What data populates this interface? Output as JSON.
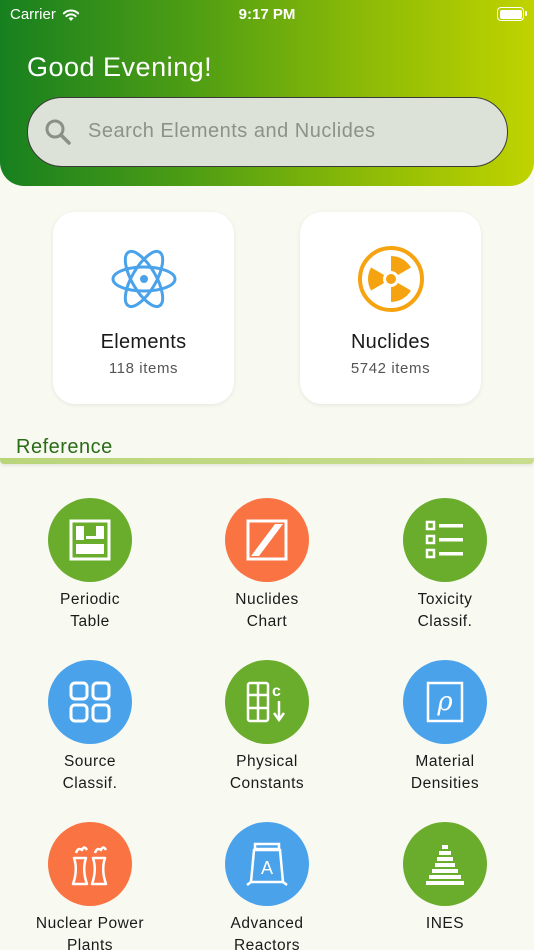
{
  "status_bar": {
    "carrier": "Carrier",
    "time": "9:17 PM"
  },
  "header": {
    "greeting": "Good Evening!"
  },
  "search": {
    "placeholder": "Search Elements and Nuclides"
  },
  "cards": [
    {
      "title": "Elements",
      "subtitle": "118 items",
      "icon": "atom-icon"
    },
    {
      "title": "Nuclides",
      "subtitle": "5742 items",
      "icon": "radiation-icon"
    }
  ],
  "reference": {
    "title": "Reference",
    "items": [
      {
        "line1": "Periodic",
        "line2": "Table",
        "icon": "periodic-table-icon",
        "color": "#6aac2c"
      },
      {
        "line1": "Nuclides",
        "line2": "Chart",
        "icon": "nuclides-chart-icon",
        "color": "#fa7343"
      },
      {
        "line1": "Toxicity",
        "line2": "Classif.",
        "icon": "list-icon",
        "color": "#6aac2c"
      },
      {
        "line1": "Source",
        "line2": "Classif.",
        "icon": "grid-icon",
        "color": "#4aa3ea"
      },
      {
        "line1": "Physical",
        "line2": "Constants",
        "icon": "constants-icon",
        "color": "#6aac2c"
      },
      {
        "line1": "Material",
        "line2": "Densities",
        "icon": "rho-icon",
        "color": "#4aa3ea"
      },
      {
        "line1": "Nuclear Power",
        "line2": "Plants",
        "icon": "cooling-tower-icon",
        "color": "#fa7343"
      },
      {
        "line1": "Advanced",
        "line2": "Reactors",
        "icon": "reactor-icon",
        "color": "#4aa3ea"
      },
      {
        "line1": "INES",
        "line2": "",
        "icon": "ines-pyramid-icon",
        "color": "#6aac2c"
      }
    ]
  },
  "colors": {
    "header_start": "#17801f",
    "header_end": "#c0d300",
    "accent_green": "#2a6b16",
    "atom_blue": "#4aa3ea",
    "radiation_orange": "#f5a311"
  }
}
